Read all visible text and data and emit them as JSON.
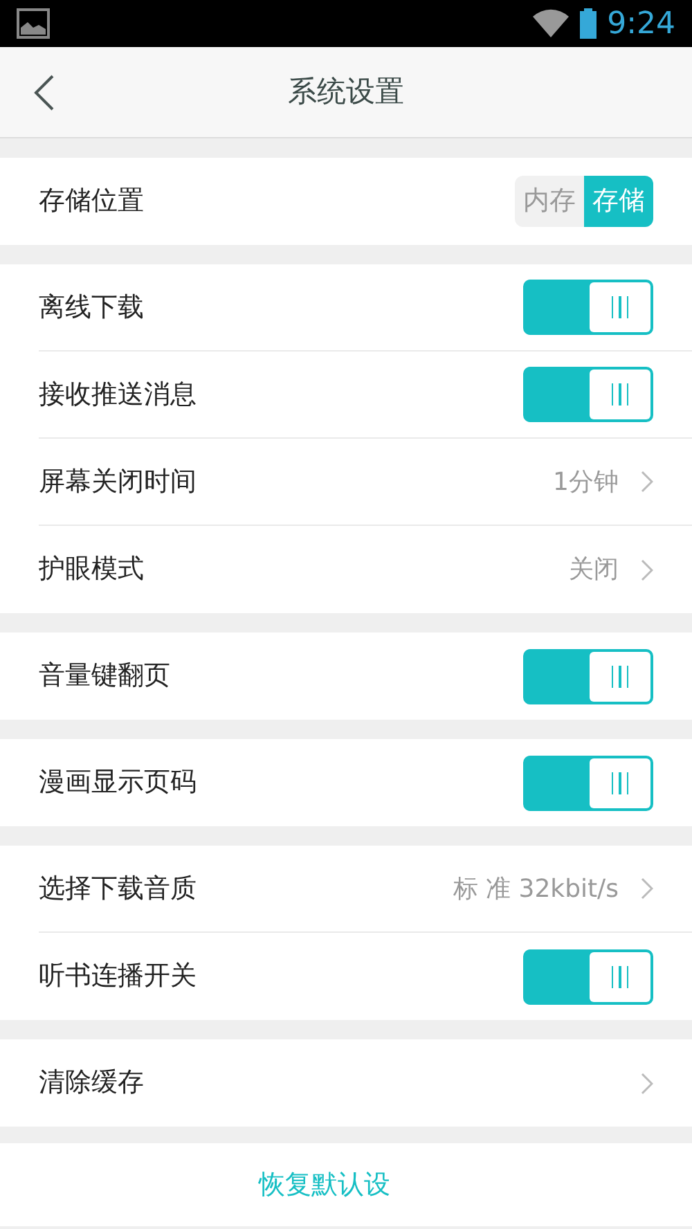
{
  "status_bar": {
    "time": "9:24"
  },
  "header": {
    "title": "系统设置"
  },
  "groups": [
    {
      "items": [
        {
          "kind": "segmented",
          "label": "存储位置",
          "options": [
            {
              "label": "内存",
              "selected": false
            },
            {
              "label": "存储",
              "selected": true
            }
          ]
        }
      ]
    },
    {
      "items": [
        {
          "kind": "toggle",
          "label": "离线下载",
          "on": true
        },
        {
          "kind": "toggle",
          "label": "接收推送消息",
          "on": true
        },
        {
          "kind": "link",
          "label": "屏幕关闭时间",
          "value": "1分钟"
        },
        {
          "kind": "link",
          "label": "护眼模式",
          "value": "关闭"
        }
      ]
    },
    {
      "items": [
        {
          "kind": "toggle",
          "label": "音量键翻页",
          "on": true
        }
      ]
    },
    {
      "items": [
        {
          "kind": "toggle",
          "label": "漫画显示页码",
          "on": true
        }
      ]
    },
    {
      "items": [
        {
          "kind": "link",
          "label": "选择下载音质",
          "value": "标 准 32kbit/s"
        },
        {
          "kind": "toggle",
          "label": "听书连播开关",
          "on": true
        }
      ]
    },
    {
      "items": [
        {
          "kind": "link",
          "label": "清除缓存"
        }
      ]
    }
  ],
  "restore_button": {
    "label": "恢复默认设"
  }
}
